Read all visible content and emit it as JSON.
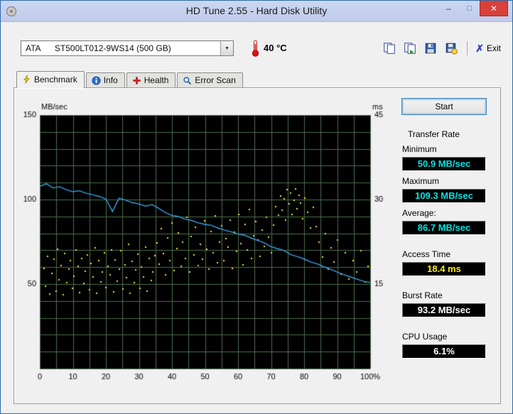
{
  "window": {
    "title": "HD Tune 2.55 - Hard Disk Utility",
    "controls": {
      "minimize": "–",
      "maximize": "□",
      "close": "✕"
    }
  },
  "toolbar": {
    "drive_select": "ATA      ST500LT012-9WS14 (500 GB)",
    "temperature": "40 °C",
    "exit_label": "Exit"
  },
  "icons": {
    "dropdown_arrow": "▼",
    "exit_x": "✗"
  },
  "tabs": [
    {
      "label": "Benchmark",
      "active": true
    },
    {
      "label": "Info",
      "active": false
    },
    {
      "label": "Health",
      "active": false
    },
    {
      "label": "Error Scan",
      "active": false
    }
  ],
  "benchmark": {
    "start_label": "Start",
    "transfer_rate": {
      "title": "Transfer Rate",
      "minimum_label": "Minimum",
      "minimum": "50.9 MB/sec",
      "maximum_label": "Maximum",
      "maximum": "109.3 MB/sec",
      "average_label": "Average:",
      "average": "86.7 MB/sec"
    },
    "access_time": {
      "title": "Access Time",
      "value": "18.4 ms"
    },
    "burst_rate": {
      "title": "Burst Rate",
      "value": "93.2 MB/sec"
    },
    "cpu_usage": {
      "title": "CPU Usage",
      "value": "6.1%"
    }
  },
  "colors": {
    "transfer_value": "#00e5e5",
    "access_value": "#ffef00",
    "generic_value": "#ffffff"
  },
  "chart_data": {
    "type": "line+scatter",
    "plot_bg": "#000000",
    "grid_color": "#4c6e4c",
    "grid": {
      "x_step": 5,
      "y_step": 10
    },
    "x_axis": {
      "min": 0,
      "max": 100,
      "ticks": [
        0,
        10,
        20,
        30,
        40,
        50,
        60,
        70,
        80,
        90,
        100
      ],
      "unit": "%"
    },
    "left_axis": {
      "label": "MB/sec",
      "min": 0,
      "max": 150,
      "ticks": [
        50,
        100,
        150
      ]
    },
    "right_axis": {
      "label": "ms",
      "min": 0,
      "max": 45,
      "ticks": [
        15,
        30,
        45
      ]
    },
    "series": [
      {
        "name": "transfer_rate",
        "type": "line",
        "color": "#38a2e8",
        "x_start": 0,
        "x_step": 2,
        "values": [
          107.8,
          109.3,
          106.9,
          107.6,
          105.8,
          104.6,
          105.2,
          103.7,
          102.9,
          101.8,
          100.3,
          92.9,
          100.8,
          99.6,
          98.2,
          97.4,
          96.1,
          97.0,
          94.8,
          92.3,
          90.6,
          89.9,
          88.4,
          87.6,
          86.2,
          85.3,
          84.7,
          83.1,
          81.9,
          80.8,
          79.6,
          78.9,
          77.2,
          75.8,
          74.3,
          72.1,
          70.9,
          69.8,
          67.4,
          66.2,
          64.8,
          63.1,
          61.9,
          60.2,
          58.8,
          57.1,
          55.6,
          54.2,
          52.9,
          51.6,
          50.9
        ]
      },
      {
        "name": "access_time",
        "type": "scatter",
        "color": "#e3e63c",
        "points": [
          [
            1.2,
            17.8
          ],
          [
            1.8,
            14.6
          ],
          [
            2.4,
            19.9
          ],
          [
            3.1,
            13.2
          ],
          [
            3.6,
            16.9
          ],
          [
            4.2,
            19.4
          ],
          [
            4.9,
            13.8
          ],
          [
            5.3,
            21.2
          ],
          [
            5.9,
            15.7
          ],
          [
            6.4,
            18.3
          ],
          [
            7.0,
            13.1
          ],
          [
            7.5,
            20.4
          ],
          [
            8.1,
            15.2
          ],
          [
            8.8,
            17.6
          ],
          [
            9.3,
            19.1
          ],
          [
            9.9,
            14.3
          ],
          [
            10.4,
            16.4
          ],
          [
            11.0,
            21.0
          ],
          [
            11.6,
            18.2
          ],
          [
            12.1,
            13.5
          ],
          [
            12.7,
            19.6
          ],
          [
            13.3,
            15.1
          ],
          [
            13.8,
            17.3
          ],
          [
            14.4,
            20.2
          ],
          [
            15.0,
            14.0
          ],
          [
            15.5,
            18.6
          ],
          [
            16.1,
            16.2
          ],
          [
            16.7,
            21.4
          ],
          [
            17.2,
            13.3
          ],
          [
            17.8,
            19.2
          ],
          [
            18.4,
            15.4
          ],
          [
            18.9,
            17.1
          ],
          [
            19.5,
            20.6
          ],
          [
            20.1,
            14.4
          ],
          [
            20.6,
            18.1
          ],
          [
            21.2,
            16.6
          ],
          [
            21.8,
            21.1
          ],
          [
            22.3,
            13.6
          ],
          [
            22.9,
            19.3
          ],
          [
            23.5,
            15.5
          ],
          [
            24.0,
            17.7
          ],
          [
            24.6,
            20.9
          ],
          [
            25.2,
            14.1
          ],
          [
            25.7,
            18.4
          ],
          [
            26.3,
            16.1
          ],
          [
            26.9,
            22.0
          ],
          [
            27.4,
            13.4
          ],
          [
            28.0,
            19.0
          ],
          [
            28.6,
            15.3
          ],
          [
            29.1,
            17.5
          ],
          [
            29.7,
            20.3
          ],
          [
            30.3,
            14.2
          ],
          [
            30.8,
            18.0
          ],
          [
            31.4,
            16.3
          ],
          [
            32.0,
            21.6
          ],
          [
            32.5,
            13.7
          ],
          [
            33.1,
            19.5
          ],
          [
            33.7,
            15.6
          ],
          [
            34.2,
            17.2
          ],
          [
            34.8,
            20.1
          ],
          [
            35.5,
            22.3
          ],
          [
            36.2,
            18.5
          ],
          [
            36.8,
            24.8
          ],
          [
            37.5,
            20.4
          ],
          [
            38.1,
            16.7
          ],
          [
            38.8,
            23.2
          ],
          [
            39.4,
            19.1
          ],
          [
            40.1,
            25.9
          ],
          [
            40.7,
            17.4
          ],
          [
            41.4,
            21.3
          ],
          [
            42.0,
            24.1
          ],
          [
            42.7,
            18.2
          ],
          [
            43.3,
            22.5
          ],
          [
            44.0,
            19.6
          ],
          [
            44.6,
            26.8
          ],
          [
            45.3,
            17.2
          ],
          [
            45.9,
            23.4
          ],
          [
            46.6,
            20.2
          ],
          [
            47.2,
            25.1
          ],
          [
            47.9,
            18.3
          ],
          [
            48.5,
            22.1
          ],
          [
            49.2,
            19.4
          ],
          [
            49.8,
            26.2
          ],
          [
            50.5,
            21.2
          ],
          [
            51.1,
            17.6
          ],
          [
            51.8,
            24.3
          ],
          [
            52.4,
            20.6
          ],
          [
            53.1,
            27.1
          ],
          [
            53.7,
            18.8
          ],
          [
            54.4,
            22.4
          ],
          [
            55.0,
            25.3
          ],
          [
            55.7,
            19.2
          ],
          [
            56.3,
            23.1
          ],
          [
            57.0,
            21.5
          ],
          [
            57.6,
            26.4
          ],
          [
            58.3,
            17.8
          ],
          [
            58.9,
            24.2
          ],
          [
            59.6,
            20.8
          ],
          [
            60.2,
            27.3
          ],
          [
            60.9,
            22.2
          ],
          [
            61.5,
            18.4
          ],
          [
            62.2,
            25.6
          ],
          [
            62.8,
            21.1
          ],
          [
            63.5,
            28.2
          ],
          [
            64.1,
            19.5
          ],
          [
            64.8,
            23.6
          ],
          [
            65.4,
            26.1
          ],
          [
            66.1,
            22.8
          ],
          [
            66.7,
            19.9
          ],
          [
            67.4,
            24.6
          ],
          [
            68.0,
            21.7
          ],
          [
            68.7,
            26.9
          ],
          [
            69.3,
            23.3
          ],
          [
            70.0,
            20.5
          ],
          [
            70.8,
            25.4
          ],
          [
            71.5,
            28.8
          ],
          [
            72.2,
            27.2
          ],
          [
            72.9,
            30.6
          ],
          [
            73.4,
            28.1
          ],
          [
            73.9,
            30.1
          ],
          [
            74.4,
            26.3
          ],
          [
            74.9,
            31.8
          ],
          [
            75.4,
            29.2
          ],
          [
            75.9,
            31.1
          ],
          [
            76.4,
            27.4
          ],
          [
            76.9,
            29.9
          ],
          [
            77.4,
            31.9
          ],
          [
            77.9,
            28.3
          ],
          [
            78.4,
            30.8
          ],
          [
            78.9,
            29.4
          ],
          [
            79.5,
            26.6
          ],
          [
            80.2,
            30.2
          ],
          [
            81.0,
            27.7
          ],
          [
            81.9,
            24.9
          ],
          [
            82.8,
            28.6
          ],
          [
            83.7,
            25.2
          ],
          [
            84.6,
            22.4
          ],
          [
            85.5,
            19.8
          ],
          [
            86.4,
            23.9
          ],
          [
            87.3,
            17.6
          ],
          [
            88.2,
            21.4
          ],
          [
            89.1,
            18.9
          ],
          [
            90.0,
            22.8
          ],
          [
            91.2,
            16.8
          ],
          [
            92.4,
            20.6
          ],
          [
            93.6,
            15.9
          ],
          [
            94.8,
            19.2
          ],
          [
            96.0,
            17.1
          ],
          [
            97.2,
            20.9
          ],
          [
            98.4,
            15.4
          ],
          [
            99.3,
            18.2
          ]
        ]
      }
    ]
  }
}
